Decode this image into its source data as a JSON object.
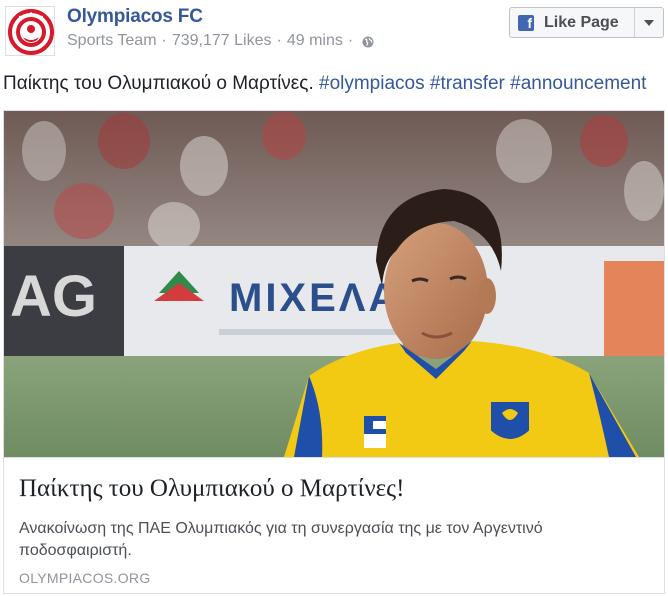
{
  "header": {
    "page_name": "Olympiacos FC",
    "category": "Sports Team",
    "likes": "739,177 Likes",
    "time": "49 mins",
    "separator": "·",
    "privacy_icon": "globe-icon",
    "avatar_icon": "club-crest-icon"
  },
  "like_button": {
    "label": "Like Page",
    "icon": "facebook-icon",
    "dropdown_icon": "caret-down-icon"
  },
  "post": {
    "text": "Παίκτης του Ολυμπιακού ο Μαρτίνες.",
    "hashtags": [
      "#olympiacos",
      "#transfer",
      "#announcement"
    ]
  },
  "link_card": {
    "image_banner_text": "ΜΙΧΕΛΑΚΗΣ",
    "title": "Παίκτης του Ολυμπιακού ο Μαρτίνες!",
    "description": "Ανακοίνωση της ΠΑΕ Ολυμπιακός για τη συνεργασία της με τον Αργεντινό ποδοσφαιριστή.",
    "domain": "OLYMPIACOS.ORG"
  },
  "colors": {
    "link_blue": "#365899",
    "meta_grey": "#90949c",
    "facebook_blue": "#4267b2",
    "crest_red": "#d7192c",
    "jersey_yellow": "#f2c913",
    "jersey_blue": "#1f4fa8"
  }
}
